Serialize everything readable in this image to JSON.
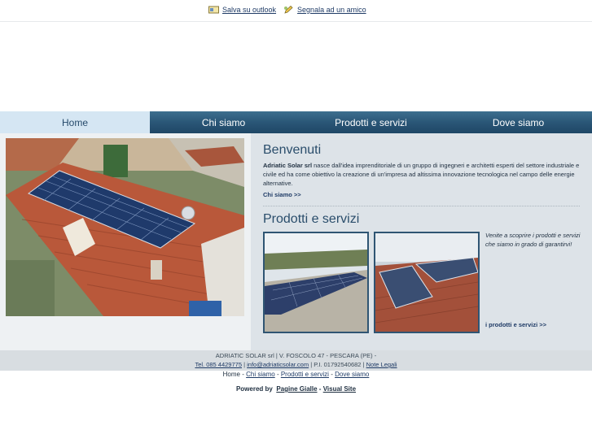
{
  "top": {
    "save_outlook": "Salva su outlook",
    "suggest_friend": "Segnala ad un amico"
  },
  "nav": {
    "items": [
      "Home",
      "Chi siamo",
      "Prodotti e servizi",
      "Dove siamo"
    ],
    "active": "Home"
  },
  "welcome": {
    "title": "Benvenuti",
    "company": "Adriatic Solar srl",
    "text": " nasce dall'idea imprenditoriale di un gruppo di ingegneri e architetti esperti del settore industriale e civile ed ha come obiettivo la creazione di un'impresa ad altissima innovazione tecnologica nel campo delle energie alternative.",
    "more_label": "Chi siamo >>"
  },
  "products": {
    "title": "Prodotti e servizi",
    "note": "Venite a scoprire i prodotti e servizi che siamo in grado di garantirvi!",
    "more_label": "i prodotti e servizi >>"
  },
  "footer": {
    "line1": "ADRIATIC SOLAR srl | V. FOSCOLO 47 - PESCARA (PE) -",
    "tel": "Tel. 085 4429775",
    "sep1": " | ",
    "email": "info@adriaticsolar.com",
    "piva": " | P.I. 01792540682 | ",
    "legal": "Note Legali",
    "nav": [
      "Home",
      "Chi siamo",
      "Prodotti e servizi",
      "Dove siamo"
    ],
    "powered_prefix": "Powered by",
    "pagine_gialle": "Pagine Gialle",
    "dash": "-",
    "visual_site": "Visual Site"
  },
  "colors": {
    "nav_dark": "#2a5677",
    "nav_active": "#d5e6f3",
    "heading": "#2a4d6b",
    "link": "#1f3b66"
  }
}
